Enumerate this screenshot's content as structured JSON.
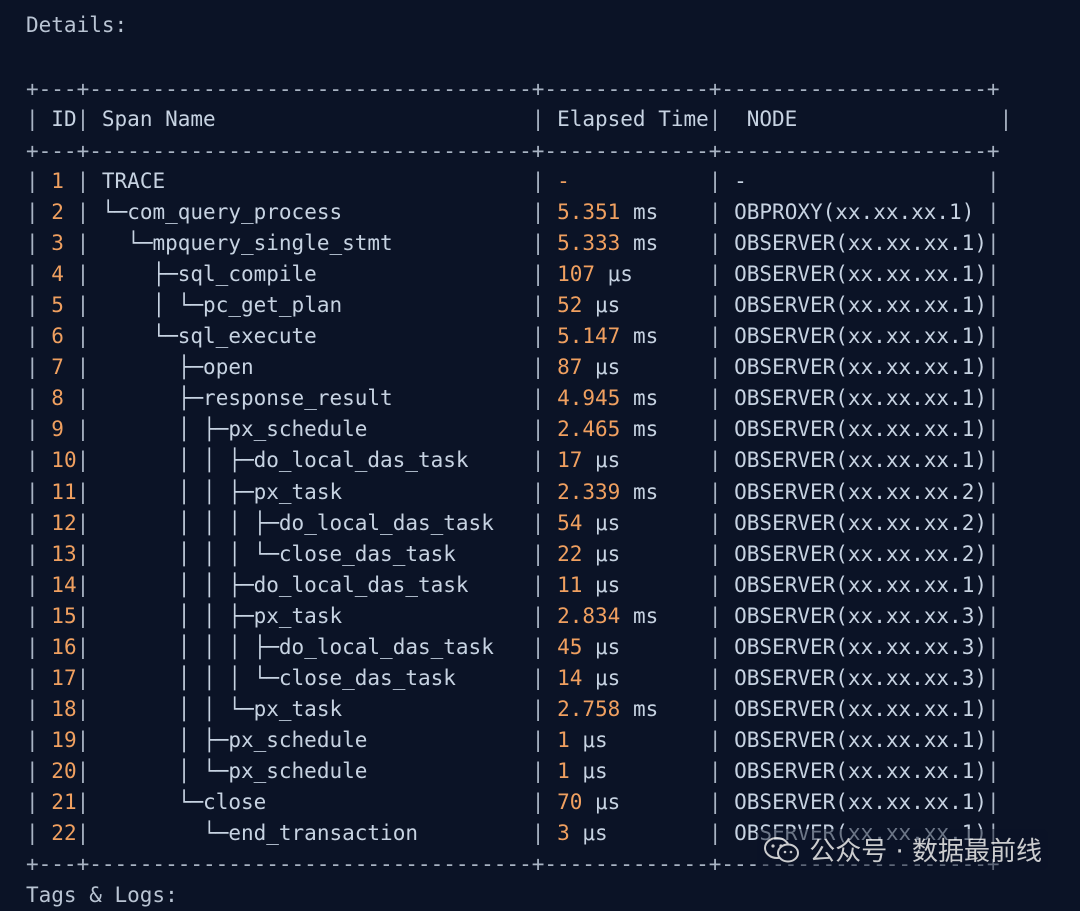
{
  "header": {
    "details_label": "Details:"
  },
  "table": {
    "border_line": "+---+-----------------------------------+-------------+---------------------+",
    "columns": {
      "id": "ID",
      "span_name": "Span Name",
      "elapsed_time": "Elapsed Time",
      "node": "NODE"
    },
    "rows": [
      {
        "id": "1",
        "tree": "",
        "name": "TRACE",
        "value": "-",
        "unit": "",
        "node": "-"
      },
      {
        "id": "2",
        "tree": "└─",
        "name": "com_query_process",
        "value": "5.351",
        "unit": "ms",
        "node": "OBPROXY(xx.xx.xx.1) "
      },
      {
        "id": "3",
        "tree": "  └─",
        "name": "mpquery_single_stmt",
        "value": "5.333",
        "unit": "ms",
        "node": "OBSERVER(xx.xx.xx.1)"
      },
      {
        "id": "4",
        "tree": "    ├─",
        "name": "sql_compile",
        "value": "107",
        "unit": "μs",
        "node": "OBSERVER(xx.xx.xx.1)"
      },
      {
        "id": "5",
        "tree": "    │ └─",
        "name": "pc_get_plan",
        "value": "52",
        "unit": "μs",
        "node": "OBSERVER(xx.xx.xx.1)"
      },
      {
        "id": "6",
        "tree": "    └─",
        "name": "sql_execute",
        "value": "5.147",
        "unit": "ms",
        "node": "OBSERVER(xx.xx.xx.1)"
      },
      {
        "id": "7",
        "tree": "      ├─",
        "name": "open",
        "value": "87",
        "unit": "μs",
        "node": "OBSERVER(xx.xx.xx.1)"
      },
      {
        "id": "8",
        "tree": "      ├─",
        "name": "response_result",
        "value": "4.945",
        "unit": "ms",
        "node": "OBSERVER(xx.xx.xx.1)"
      },
      {
        "id": "9",
        "tree": "      │ ├─",
        "name": "px_schedule",
        "value": "2.465",
        "unit": "ms",
        "node": "OBSERVER(xx.xx.xx.1)"
      },
      {
        "id": "10",
        "tree": "      │ │ ├─",
        "name": "do_local_das_task",
        "value": "17",
        "unit": "μs",
        "node": "OBSERVER(xx.xx.xx.1)"
      },
      {
        "id": "11",
        "tree": "      │ │ ├─",
        "name": "px_task",
        "value": "2.339",
        "unit": "ms",
        "node": "OBSERVER(xx.xx.xx.2)"
      },
      {
        "id": "12",
        "tree": "      │ │ │ ├─",
        "name": "do_local_das_task",
        "value": "54",
        "unit": "μs",
        "node": "OBSERVER(xx.xx.xx.2)"
      },
      {
        "id": "13",
        "tree": "      │ │ │ └─",
        "name": "close_das_task",
        "value": "22",
        "unit": "μs",
        "node": "OBSERVER(xx.xx.xx.2)"
      },
      {
        "id": "14",
        "tree": "      │ │ ├─",
        "name": "do_local_das_task",
        "value": "11",
        "unit": "μs",
        "node": "OBSERVER(xx.xx.xx.1)"
      },
      {
        "id": "15",
        "tree": "      │ │ ├─",
        "name": "px_task",
        "value": "2.834",
        "unit": "ms",
        "node": "OBSERVER(xx.xx.xx.3)"
      },
      {
        "id": "16",
        "tree": "      │ │ │ ├─",
        "name": "do_local_das_task",
        "value": "45",
        "unit": "μs",
        "node": "OBSERVER(xx.xx.xx.3)"
      },
      {
        "id": "17",
        "tree": "      │ │ │ └─",
        "name": "close_das_task",
        "value": "14",
        "unit": "μs",
        "node": "OBSERVER(xx.xx.xx.3)"
      },
      {
        "id": "18",
        "tree": "      │ │ └─",
        "name": "px_task",
        "value": "2.758",
        "unit": "ms",
        "node": "OBSERVER(xx.xx.xx.1)"
      },
      {
        "id": "19",
        "tree": "      │ ├─",
        "name": "px_schedule",
        "value": "1",
        "unit": "μs",
        "node": "OBSERVER(xx.xx.xx.1)"
      },
      {
        "id": "20",
        "tree": "      │ └─",
        "name": "px_schedule",
        "value": "1",
        "unit": "μs",
        "node": "OBSERVER(xx.xx.xx.1)"
      },
      {
        "id": "21",
        "tree": "      └─",
        "name": "close",
        "value": "70",
        "unit": "μs",
        "node": "OBSERVER(xx.xx.xx.1)"
      },
      {
        "id": "22",
        "tree": "        └─",
        "name": "end_transaction",
        "value": "3",
        "unit": "μs",
        "node": "OBSERVER(xx.xx.xx.1)"
      }
    ]
  },
  "footer": {
    "tags_label": "Tags & Logs:"
  },
  "watermark": {
    "text": "公众号 · 数据最前线",
    "icon": "wechat-icon"
  },
  "colors": {
    "background": "#0b1326",
    "text": "#c7d3e2",
    "accent": "#f0a060"
  }
}
